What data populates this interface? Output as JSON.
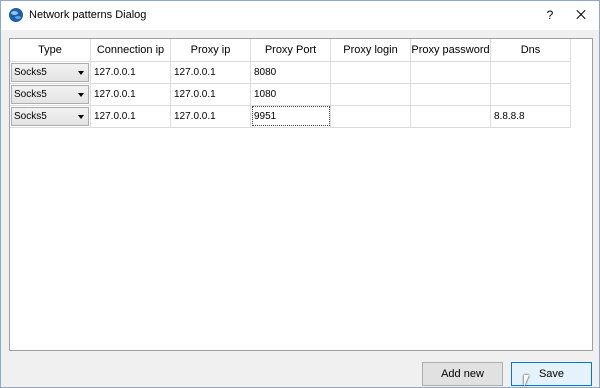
{
  "window": {
    "title": "Network patterns Dialog",
    "help_label": "?",
    "app_icon": "globe-icon",
    "close_icon": "close-icon"
  },
  "table": {
    "headers": [
      "Type",
      "Connection ip",
      "Proxy ip",
      "Proxy Port",
      "Proxy login",
      "Proxy password",
      "Dns"
    ],
    "rows": [
      {
        "type": "Socks5",
        "connection_ip": "127.0.0.1",
        "proxy_ip": "127.0.0.1",
        "proxy_port": "8080",
        "proxy_login": "",
        "proxy_password": "",
        "dns": ""
      },
      {
        "type": "Socks5",
        "connection_ip": "127.0.0.1",
        "proxy_ip": "127.0.0.1",
        "proxy_port": "1080",
        "proxy_login": "",
        "proxy_password": "",
        "dns": ""
      },
      {
        "type": "Socks5",
        "connection_ip": "127.0.0.1",
        "proxy_ip": "127.0.0.1",
        "proxy_port": "9951",
        "proxy_login": "",
        "proxy_password": "",
        "dns": "8.8.8.8"
      }
    ]
  },
  "buttons": {
    "add_new": "Add new",
    "save": "Save"
  },
  "colors": {
    "focus_border": "#0078d7",
    "button_face": "#e1e1e1"
  }
}
